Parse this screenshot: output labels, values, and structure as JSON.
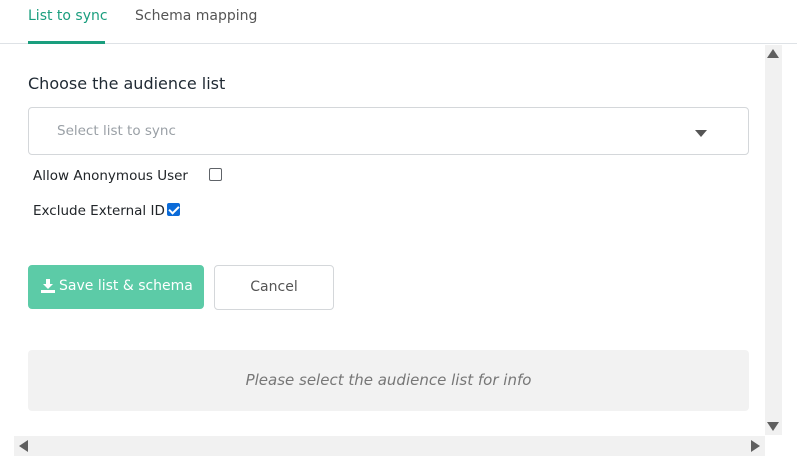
{
  "tabs": [
    {
      "label": "List to sync",
      "active": true
    },
    {
      "label": "Schema mapping",
      "active": false
    }
  ],
  "form": {
    "title": "Choose the audience list",
    "select": {
      "placeholder": "Select list to sync"
    },
    "allow_anonymous": {
      "label": "Allow Anonymous User",
      "checked": false
    },
    "exclude_external": {
      "label": "Exclude External ID",
      "checked": true
    }
  },
  "actions": {
    "save_label": "Save list & schema",
    "cancel_label": "Cancel"
  },
  "info": {
    "message": "Please select the audience list for info"
  },
  "colors": {
    "accent": "#1a9e7e",
    "save_button": "#5ccba7",
    "checkbox_checked": "#0b6bd8",
    "info_background": "#f2f2f2"
  },
  "icons": {
    "save": "download-icon",
    "select": "caret-down-icon"
  }
}
